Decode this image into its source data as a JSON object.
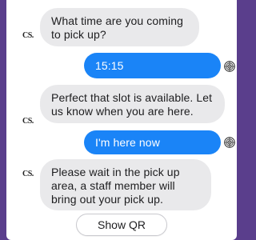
{
  "messages": [
    {
      "from": "bot",
      "avatar": "CS.",
      "text": "What time are you coming to pick up?"
    },
    {
      "from": "user",
      "text": "15:15"
    },
    {
      "from": "bot",
      "avatar": "CS.",
      "text": "Perfect that slot is available. Let us know when you are here."
    },
    {
      "from": "user",
      "text": "I'm here now"
    },
    {
      "from": "bot",
      "avatar": "CS.",
      "text": "Please wait in the pick up area, a staff member will bring out your pick up."
    }
  ],
  "action": {
    "label": "Show QR"
  },
  "colors": {
    "frame": "#5a3e8c",
    "bubble_in": "#e9e9eb",
    "bubble_out": "#1a84f7"
  },
  "icons": {
    "bot_avatar": "cs-logo-icon",
    "user_avatar": "user-avatar-icon"
  }
}
